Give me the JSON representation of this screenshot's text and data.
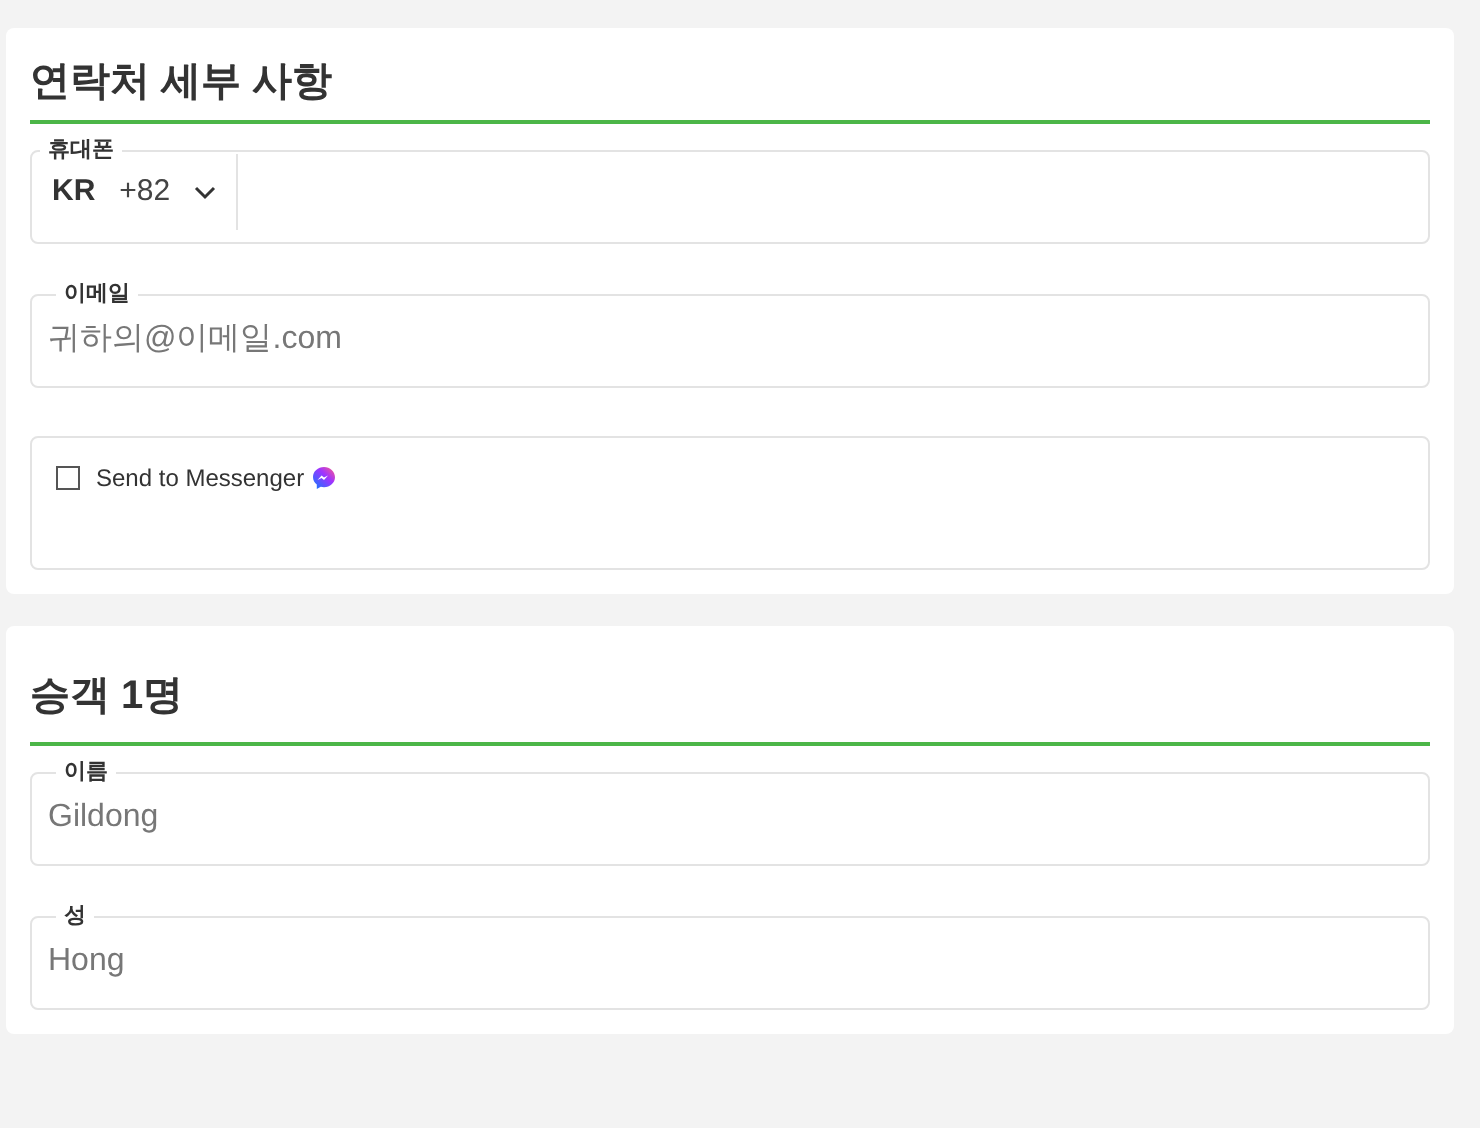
{
  "contact": {
    "title": "연락처 세부 사항",
    "phone": {
      "label": "휴대폰",
      "country": "KR",
      "code": "+82"
    },
    "email": {
      "label": "이메일",
      "placeholder": "귀하의@이메일.com"
    },
    "messenger": {
      "label": "Send to Messenger",
      "checked": false
    }
  },
  "passenger": {
    "title": "승객 1명",
    "fields": [
      {
        "label": "이름",
        "placeholder": "Gildong"
      },
      {
        "label": "성",
        "placeholder": "Hong"
      }
    ]
  }
}
